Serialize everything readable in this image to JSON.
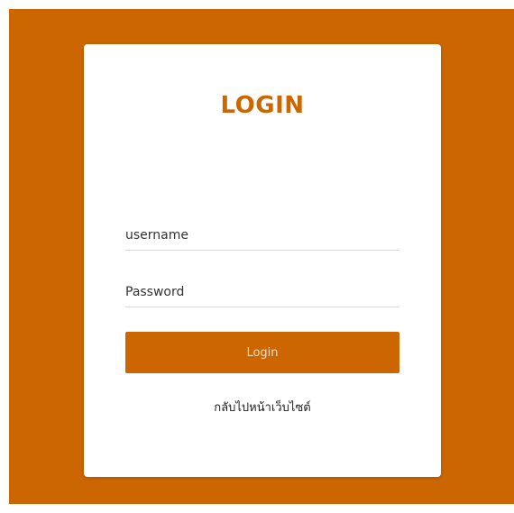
{
  "colors": {
    "accent": "#cc6600",
    "background": "#cc6600",
    "card": "#ffffff",
    "button_text": "#f3d9bf"
  },
  "login": {
    "title": "LOGIN",
    "username": {
      "placeholder": "username",
      "value": ""
    },
    "password": {
      "placeholder": "Password",
      "value": ""
    },
    "submit_label": "Login",
    "back_link": "กลับไปหน้าเว็บไซต์"
  }
}
